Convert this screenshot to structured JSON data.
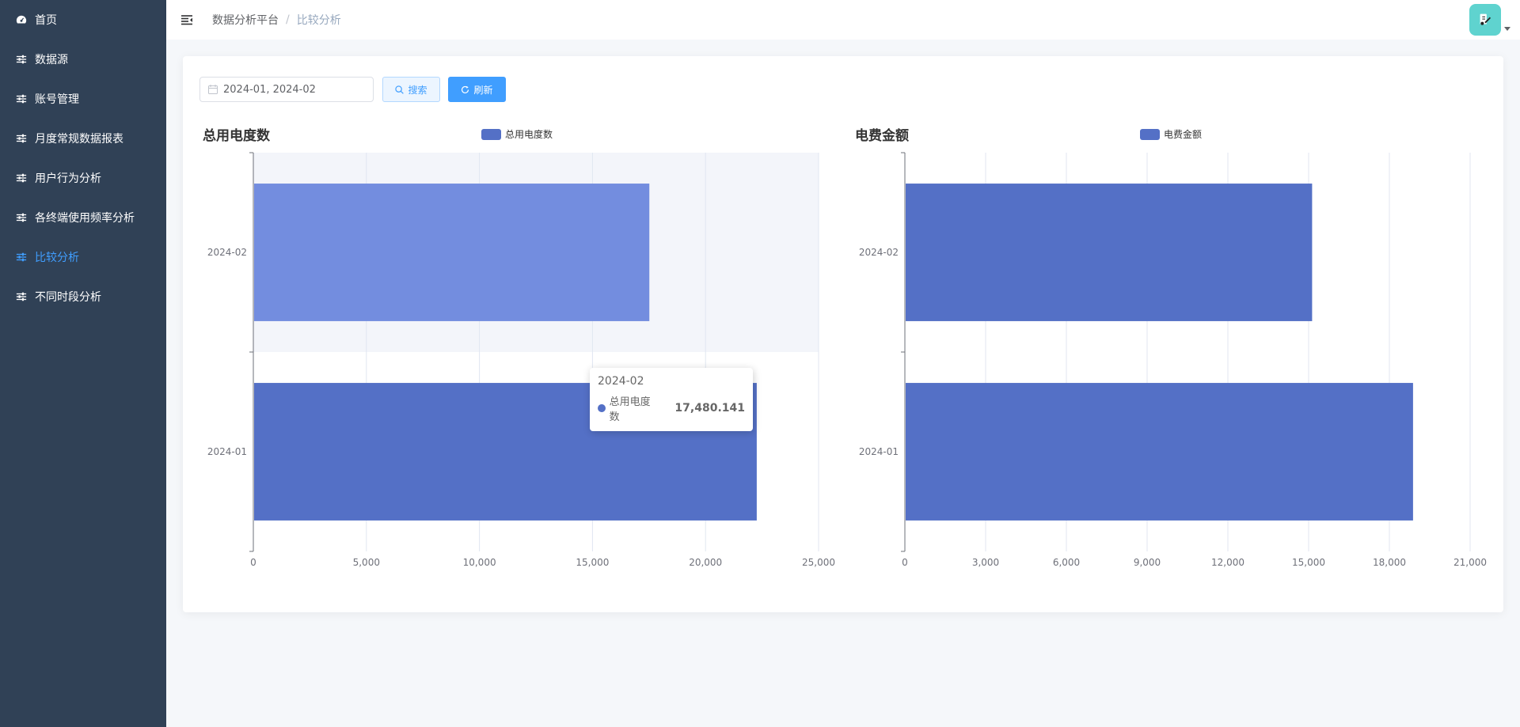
{
  "sidebar": {
    "items": [
      {
        "label": "首页",
        "icon": "dashboard-icon",
        "active": false
      },
      {
        "label": "数据源",
        "icon": "sliders-icon",
        "active": false
      },
      {
        "label": "账号管理",
        "icon": "sliders-icon",
        "active": false
      },
      {
        "label": "月度常规数据报表",
        "icon": "sliders-icon",
        "active": false
      },
      {
        "label": "用户行为分析",
        "icon": "sliders-icon",
        "active": false
      },
      {
        "label": "各终端使用频率分析",
        "icon": "sliders-icon",
        "active": false
      },
      {
        "label": "比较分析",
        "icon": "sliders-icon",
        "active": true
      },
      {
        "label": "不同时段分析",
        "icon": "sliders-icon",
        "active": false
      }
    ]
  },
  "navbar": {
    "breadcrumb": [
      "数据分析平台",
      "比较分析"
    ],
    "separator": "/"
  },
  "toolbar": {
    "date_range_value": "2024-01, 2024-02",
    "search_label": "搜索",
    "refresh_label": "刷新"
  },
  "colors": {
    "sidebar_bg": "#304156",
    "accent": "#409eff",
    "bar": "#5470c6",
    "bar_hover": "#738ddf"
  },
  "chart_data": [
    {
      "type": "bar",
      "orientation": "horizontal",
      "title": "总用电度数",
      "categories": [
        "2024-01",
        "2024-02"
      ],
      "series": [
        {
          "name": "总用电度数",
          "values": [
            22230,
            17480.141
          ]
        }
      ],
      "xlim": [
        0,
        25000
      ],
      "xticks": [
        "0",
        "5,000",
        "10,000",
        "15,000",
        "20,000",
        "25,000"
      ],
      "grid": true,
      "legend": "top",
      "highlighted_category": "2024-02"
    },
    {
      "type": "bar",
      "orientation": "horizontal",
      "title": "电费金额",
      "categories": [
        "2024-01",
        "2024-02"
      ],
      "series": [
        {
          "name": "电费金额",
          "values": [
            18850,
            15100
          ]
        }
      ],
      "xlim": [
        0,
        21000
      ],
      "xticks": [
        "0",
        "3,000",
        "6,000",
        "9,000",
        "12,000",
        "15,000",
        "18,000",
        "21,000"
      ],
      "grid": true,
      "legend": "top"
    }
  ],
  "tooltip": {
    "title": "2024-02",
    "series_name": "总用电度数",
    "value": "17,480.141"
  }
}
